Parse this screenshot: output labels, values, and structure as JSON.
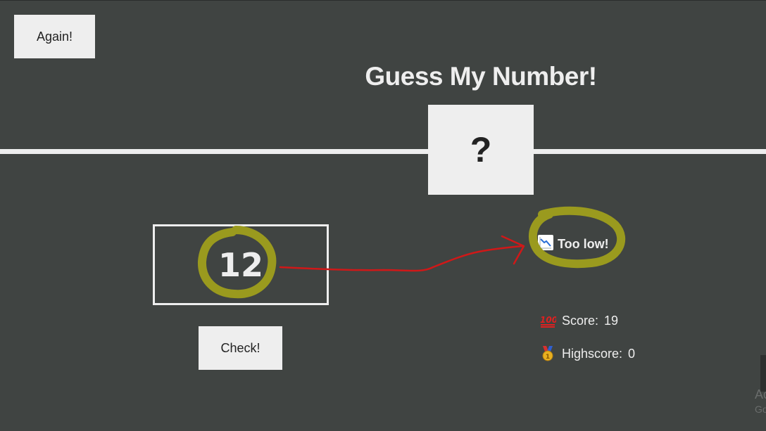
{
  "buttons": {
    "again_label": "Again!",
    "check_label": "Check!"
  },
  "game": {
    "title": "Guess My Number!",
    "secret_placeholder": "?",
    "guess_value": "12",
    "message": "Too low!",
    "score_label": "Score:",
    "score_value": "19",
    "highscore_label": "Highscore:",
    "highscore_value": "0"
  },
  "icons": {
    "message_icon": "chart-decreasing-icon",
    "score_icon": "hundred-points-icon",
    "highscore_icon": "medal-icon"
  },
  "overlay": {
    "edge_text_1": "Ac",
    "edge_text_2": "Go"
  },
  "colors": {
    "background": "#404442",
    "foreground": "#eeeeee",
    "annotation_highlight": "#9a9a1e",
    "annotation_arrow": "#d01818"
  }
}
